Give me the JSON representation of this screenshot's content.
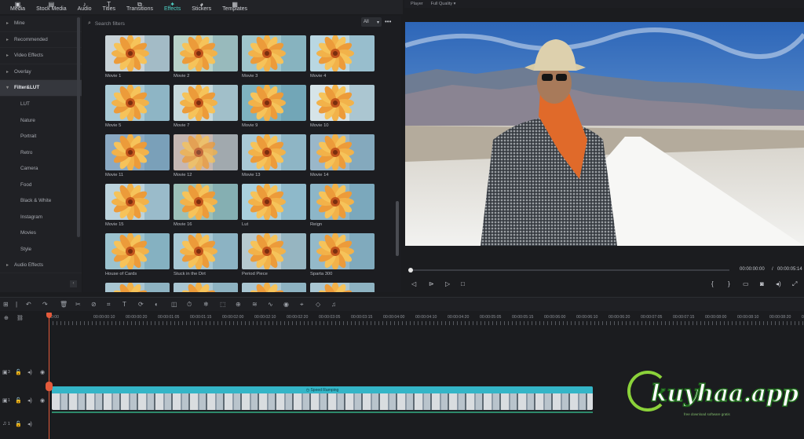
{
  "toolbar": {
    "tabs": [
      {
        "label": "Media",
        "icon": "media-icon"
      },
      {
        "label": "Stock Media",
        "icon": "stock-media-icon"
      },
      {
        "label": "Audio",
        "icon": "audio-icon"
      },
      {
        "label": "Titles",
        "icon": "titles-icon"
      },
      {
        "label": "Transitions",
        "icon": "transitions-icon"
      },
      {
        "label": "Effects",
        "icon": "effects-icon"
      },
      {
        "label": "Stickers",
        "icon": "stickers-icon"
      },
      {
        "label": "Templates",
        "icon": "templates-icon"
      }
    ],
    "active": "Effects"
  },
  "sidebar": {
    "items": [
      {
        "label": "Mine",
        "level": 0
      },
      {
        "label": "Recommended",
        "level": 0
      },
      {
        "label": "Video Effects",
        "level": 0
      },
      {
        "label": "Overlay",
        "level": 0
      },
      {
        "label": "Filter&LUT",
        "level": 0,
        "active": true,
        "expanded": true
      },
      {
        "label": "LUT",
        "level": 1
      },
      {
        "label": "Nature",
        "level": 1
      },
      {
        "label": "Portrait",
        "level": 1
      },
      {
        "label": "Retro",
        "level": 1
      },
      {
        "label": "Camera",
        "level": 1
      },
      {
        "label": "Food",
        "level": 1
      },
      {
        "label": "Black & White",
        "level": 1
      },
      {
        "label": "Instagram",
        "level": 1
      },
      {
        "label": "Movies",
        "level": 1
      },
      {
        "label": "Style",
        "level": 1
      },
      {
        "label": "Audio Effects",
        "level": 0
      }
    ]
  },
  "library": {
    "search_placeholder": "Search filters",
    "filter_value": "All",
    "filters": [
      {
        "label": "Movie 1",
        "tone": "#c9d3d8"
      },
      {
        "label": "Movie 2",
        "tone": "#b8d2c8"
      },
      {
        "label": "Movie 3",
        "tone": "#9fc6cc"
      },
      {
        "label": "Movie 4",
        "tone": "#b9d7e2"
      },
      {
        "label": "Movie 5",
        "tone": "#a9cad6"
      },
      {
        "label": "Movie 7",
        "tone": "#c7d9dc"
      },
      {
        "label": "Movie 9",
        "tone": "#7fb3c0"
      },
      {
        "label": "Movie 10",
        "tone": "#d6e4e8"
      },
      {
        "label": "Movie 11",
        "tone": "#8aa9c3"
      },
      {
        "label": "Movie 12",
        "tone": "#c6b7b2"
      },
      {
        "label": "Movie 13",
        "tone": "#a9c9d6"
      },
      {
        "label": "Movie 14",
        "tone": "#9ab7c9"
      },
      {
        "label": "Movie 15",
        "tone": "#bcd3dd"
      },
      {
        "label": "Movie 16",
        "tone": "#9cc0b8"
      },
      {
        "label": "Lut",
        "tone": "#a9d0dd"
      },
      {
        "label": "Reign",
        "tone": "#8db6c8"
      },
      {
        "label": "House of Cards",
        "tone": "#9cc3cf"
      },
      {
        "label": "Stuck in the Dirt",
        "tone": "#a7c7d3"
      },
      {
        "label": "Period Piece",
        "tone": "#b6c9cf"
      },
      {
        "label": "Sparta 300",
        "tone": "#94b9c9"
      }
    ]
  },
  "player": {
    "label": "Player",
    "quality": "Full Quality",
    "current_time": "00:00:00:00",
    "separator": "/",
    "total_time": "00:00:05:14"
  },
  "timeline": {
    "ruler": [
      "00:00",
      "00:00:00:10",
      "00:00:00:20",
      "00:00:01:05",
      "00:00:01:15",
      "00:00:02:00",
      "00:00:02:10",
      "00:00:02:20",
      "00:00:03:05",
      "00:00:03:15",
      "00:00:04:00",
      "00:00:04:10",
      "00:00:04:20",
      "00:00:05:05",
      "00:00:05:15",
      "00:00:06:00",
      "00:00:06:10",
      "00:00:06:20",
      "00:00:07:05",
      "00:00:07:15",
      "00:00:08:00",
      "00:00:08:10",
      "00:00:08:20",
      "00:00:09:05"
    ],
    "clip_label": "Speed Ramping",
    "tracks": [
      {
        "name": "3",
        "kind": "video"
      },
      {
        "name": "1",
        "kind": "video"
      },
      {
        "name": "1",
        "kind": "audio"
      }
    ]
  },
  "watermark": {
    "text": "kuyhaa.app",
    "tagline": "free download software gratis"
  },
  "colors": {
    "accent": "#4fd1c5",
    "playhead": "#e45a3b",
    "clip": "#34b5c7"
  }
}
